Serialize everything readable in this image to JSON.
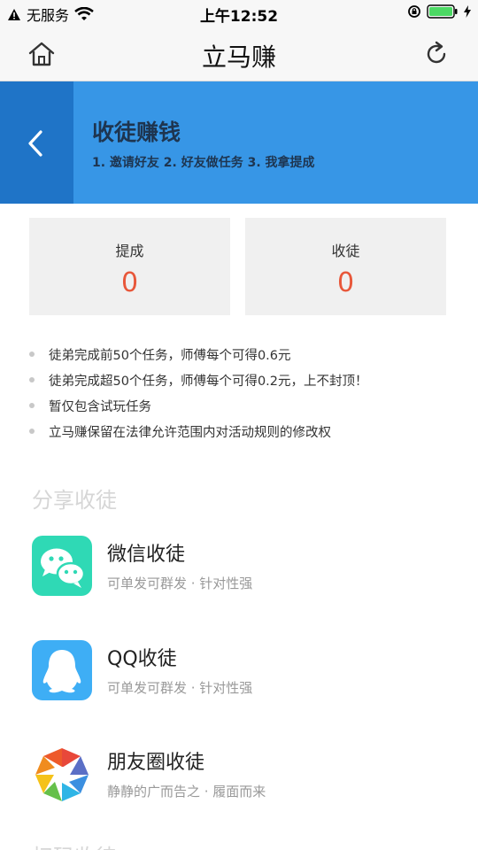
{
  "status_bar": {
    "carrier": "无服务",
    "time": "上午12:52"
  },
  "nav": {
    "title": "立马赚"
  },
  "banner": {
    "title": "收徒赚钱",
    "steps": "1. 邀请好友  2. 好友做任务  3. 我拿提成"
  },
  "stats": [
    {
      "label": "提成",
      "value": "0"
    },
    {
      "label": "收徒",
      "value": "0"
    }
  ],
  "rules": [
    "徒弟完成前50个任务，师傅每个可得0.6元",
    "徒弟完成超50个任务，师傅每个可得0.2元，上不封顶！",
    "暂仅包含试玩任务",
    "立马赚保留在法律允许范围内对活动规则的修改权"
  ],
  "share": {
    "section_title": "分享收徒",
    "items": [
      {
        "name": "微信收徒",
        "desc": "可单发可群发 · 针对性强",
        "icon": "wechat-icon"
      },
      {
        "name": "QQ收徒",
        "desc": "可单发可群发 · 针对性强",
        "icon": "qq-icon"
      },
      {
        "name": "朋友圈收徒",
        "desc": "静静的广而告之 · 履面而来",
        "icon": "moments-icon"
      }
    ]
  },
  "next_section_title": "扫码收徒",
  "colors": {
    "banner_bg": "#3796e6",
    "banner_back_bg": "#1f74c7",
    "value_red": "#e8573a",
    "wechat_green": "#2fd9b5",
    "qq_blue": "#3eaef5"
  }
}
